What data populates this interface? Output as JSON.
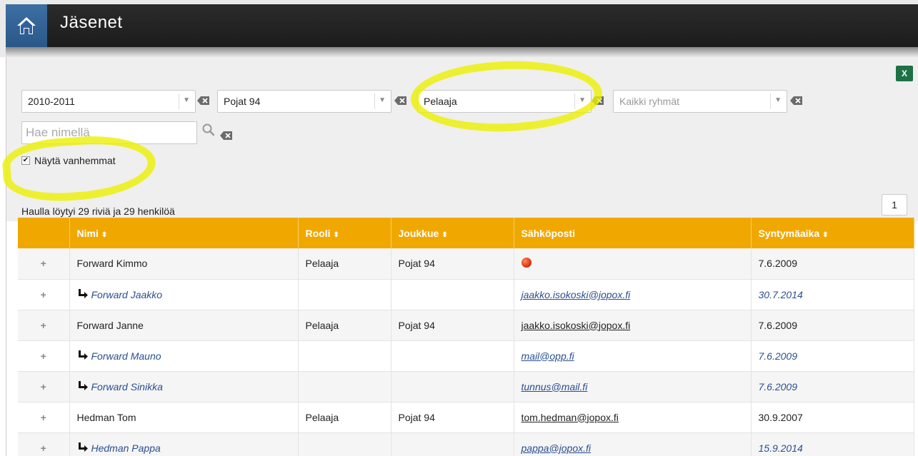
{
  "header": {
    "title": "Jäsenet"
  },
  "filters": {
    "season": {
      "value": "2010-2011"
    },
    "team": {
      "value": "Pojat 94"
    },
    "role": {
      "value": "Pelaaja"
    },
    "group": {
      "placeholder": "Kaikki ryhmät"
    },
    "search": {
      "placeholder": "Hae nimellä"
    },
    "show_parents": {
      "label": "Näytä vanhemmat",
      "checked": true
    }
  },
  "results": {
    "summary": "Haulla löytyi 29 riviä ja 29 henkilöä",
    "page": "1"
  },
  "table": {
    "columns": {
      "name": "Nimi",
      "role": "Rooli",
      "team": "Joukkue",
      "email": "Sähköposti",
      "birthdate": "Syntymäaika"
    },
    "rows": [
      {
        "type": "member",
        "name": "Forward Kimmo",
        "role": "Pelaaja",
        "team": "Pojat 94",
        "email": "",
        "email_status": "red-dot",
        "birthdate": "7.6.2009"
      },
      {
        "type": "parent",
        "name": "Forward Jaakko",
        "role": "",
        "team": "",
        "email": "jaakko.isokoski@jopox.fi",
        "birthdate": "30.7.2014"
      },
      {
        "type": "member",
        "name": "Forward Janne",
        "role": "Pelaaja",
        "team": "Pojat 94",
        "email": "jaakko.isokoski@jopox.fi",
        "birthdate": "7.6.2009"
      },
      {
        "type": "parent",
        "name": "Forward Mauno",
        "role": "",
        "team": "",
        "email": "mail@opp.fi",
        "birthdate": "7.6.2009"
      },
      {
        "type": "parent",
        "name": "Forward Sinikka",
        "role": "",
        "team": "",
        "email": "tunnus@mail.fi",
        "birthdate": "7.6.2009"
      },
      {
        "type": "member",
        "name": "Hedman Tom",
        "role": "Pelaaja",
        "team": "Pojat 94",
        "email": "tom.hedman@jopox.fi",
        "birthdate": "30.9.2007"
      },
      {
        "type": "parent",
        "name": "Hedman Pappa",
        "role": "",
        "team": "",
        "email": "pappa@jopox.fi",
        "birthdate": "15.9.2014"
      }
    ]
  },
  "icons": {
    "home": "home-icon",
    "excel": "excel-export-icon",
    "search": "search-icon",
    "clear": "clear-icon",
    "expand": "plus-icon",
    "child": "child-arrow-icon",
    "sort": "sort-icon"
  },
  "colors": {
    "header_bg": "#232323",
    "home_bg": "#3469a0",
    "table_header": "#f0a800",
    "child_link": "#2a4f8f",
    "highlight": "#ecf000"
  }
}
